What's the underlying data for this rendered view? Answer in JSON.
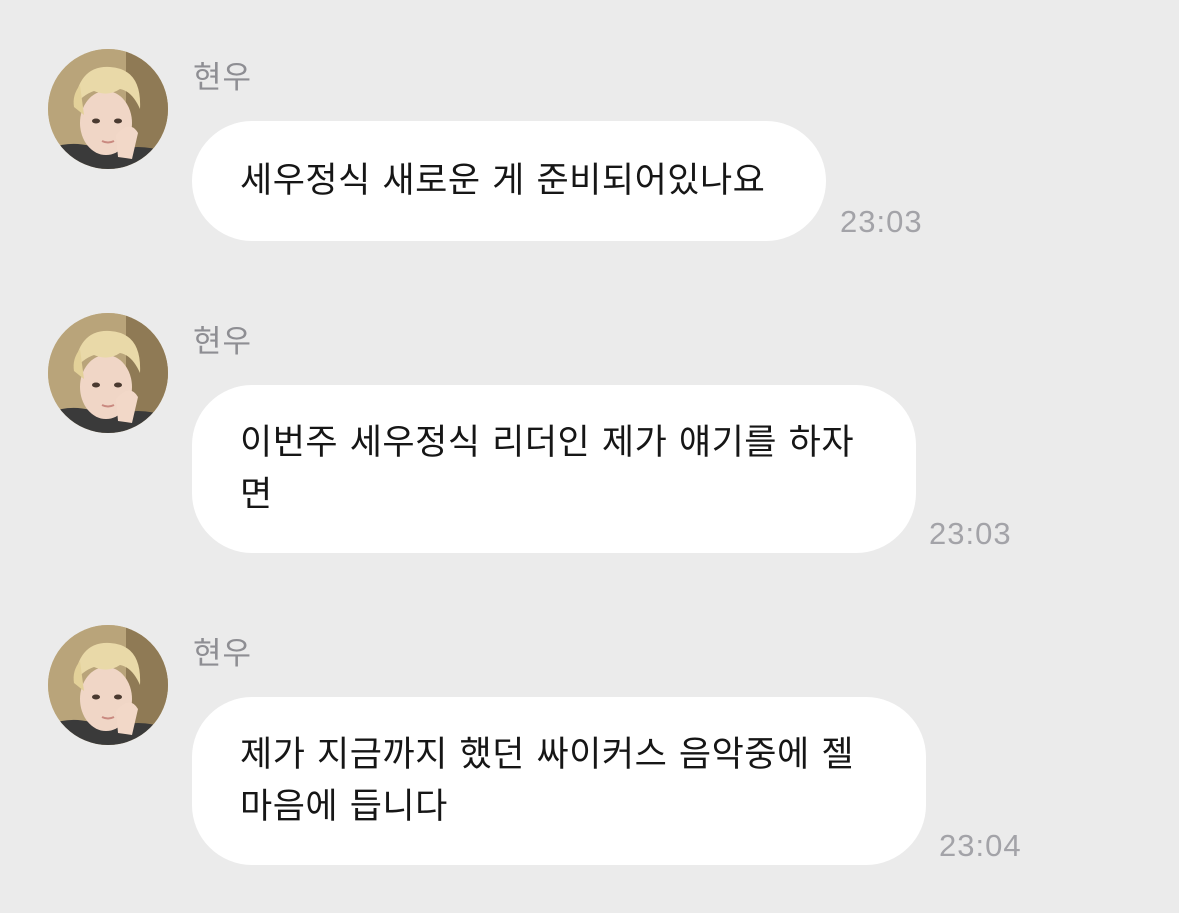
{
  "messages": [
    {
      "sender": "현우",
      "lines": [
        "세우정식 새로운 게 준비되어있나요"
      ],
      "time": "23:03"
    },
    {
      "sender": "현우",
      "lines": [
        "이번주 세우정식 리더인 제가 얘기를 하자",
        "면"
      ],
      "time": "23:03"
    },
    {
      "sender": "현우",
      "lines": [
        "제가 지금까지 했던 싸이커스 음악중에 젤",
        "마음에 듭니다"
      ],
      "time": "23:04"
    }
  ],
  "colors": {
    "background": "#ebebeb",
    "bubble": "#ffffff",
    "sender_text": "#8e8e93",
    "time_text": "#a3a3a8",
    "message_text": "#161616"
  }
}
